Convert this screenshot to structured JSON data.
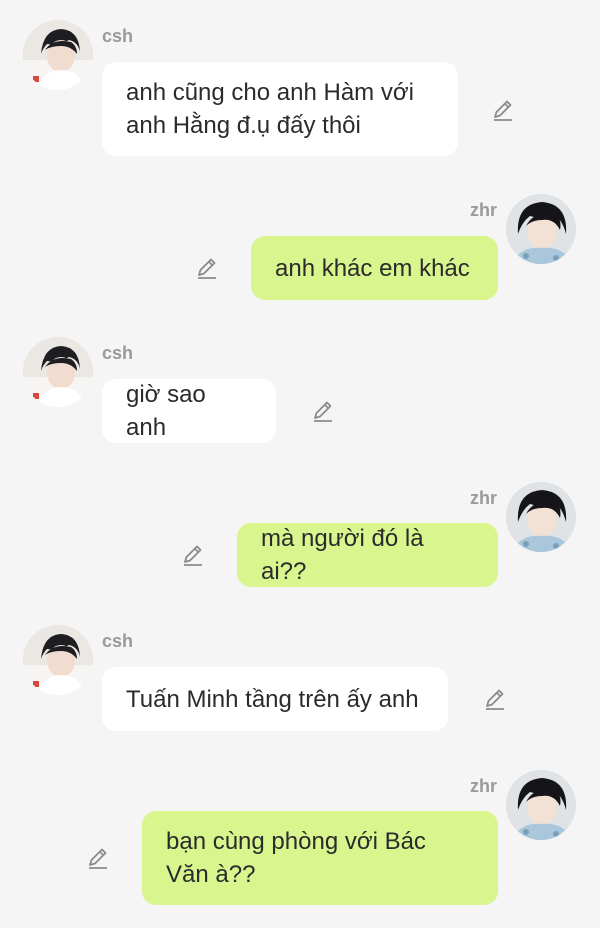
{
  "messages": [
    {
      "sender": "csh",
      "side": "left",
      "text": "anh cũng cho anh Hàm với\nanh Hằng đ.ụ đấy thôi"
    },
    {
      "sender": "zhr",
      "side": "right",
      "text": "anh khác em khác"
    },
    {
      "sender": "csh",
      "side": "left",
      "text": "giờ sao anh"
    },
    {
      "sender": "zhr",
      "side": "right",
      "text": "mà người đó là ai??"
    },
    {
      "sender": "csh",
      "side": "left",
      "text": "Tuấn Minh tầng trên ấy anh"
    },
    {
      "sender": "zhr",
      "side": "right",
      "text": "bạn cùng phòng với Bác\nVăn à??"
    }
  ],
  "icons": {
    "edit": "pencil-icon"
  },
  "colors": {
    "background": "#f5f5f5",
    "left_bubble": "#ffffff",
    "right_bubble": "#d8f58e",
    "sender_name": "#9a9a9a"
  }
}
